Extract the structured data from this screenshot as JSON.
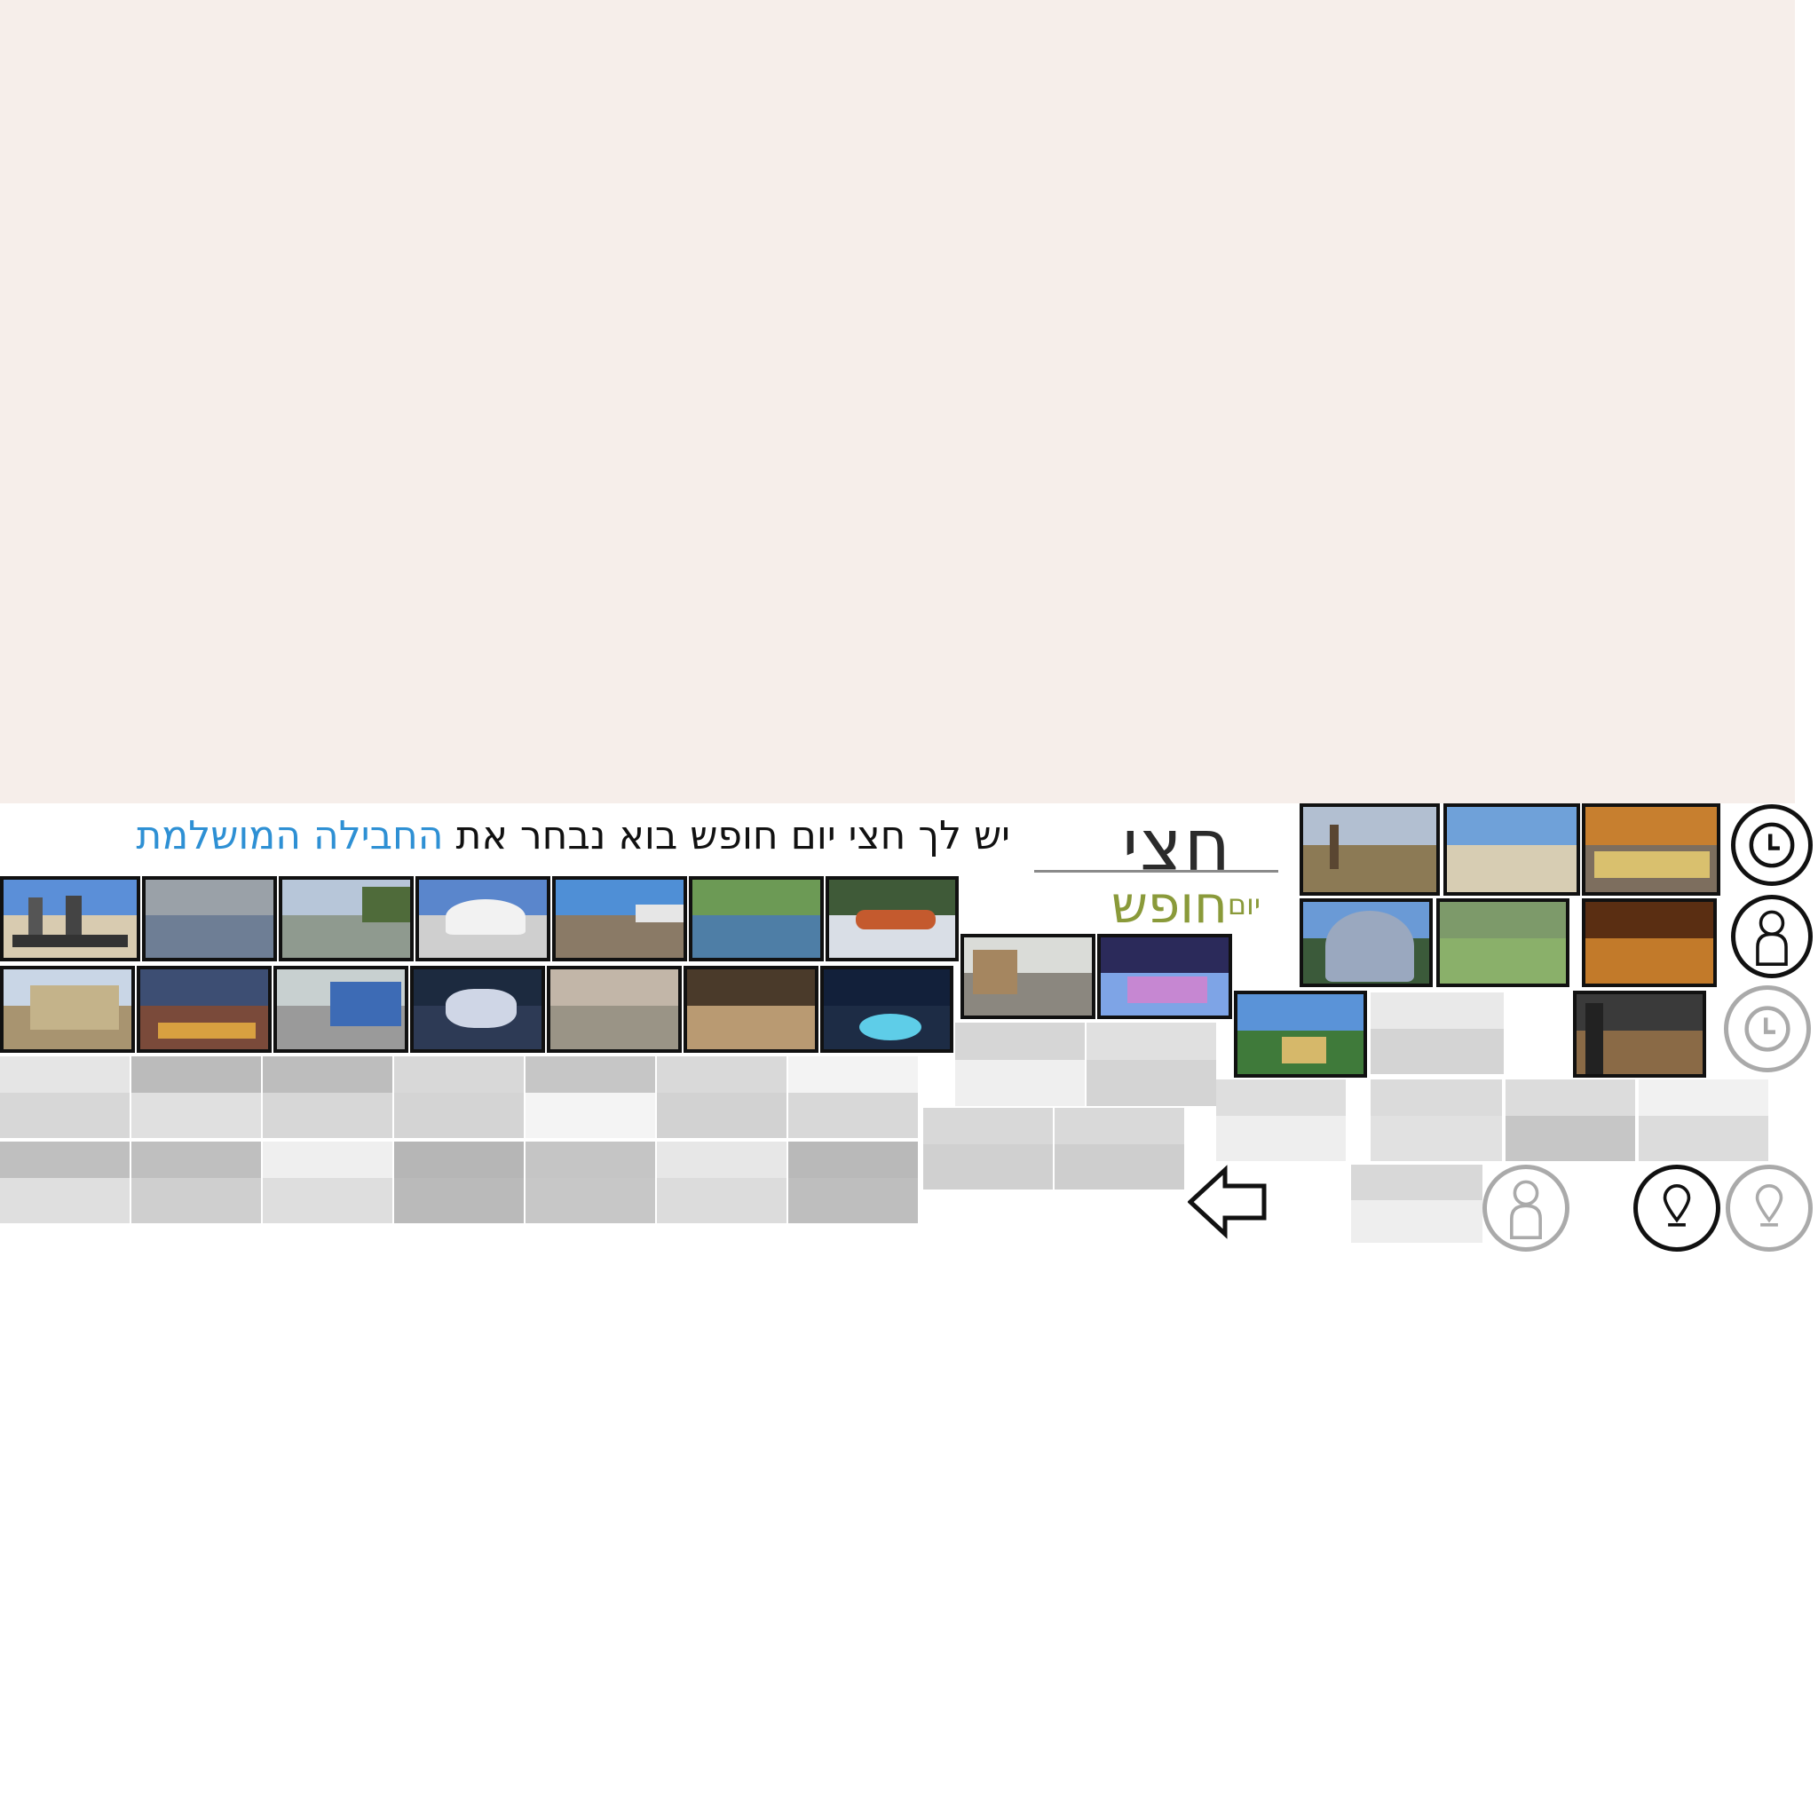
{
  "headline": {
    "prefix": "יש לך חצי יום חופש בוא נבחר את",
    "highlight": "החבילה המושלמת"
  },
  "logo": {
    "main": "חצי",
    "sub_small": "יום",
    "sub": "חופש"
  },
  "colors": {
    "background_top": "#f6eeea",
    "highlight": "#2e90d4",
    "logo_green": "#8a9a3a"
  },
  "icons": {
    "clock": "clock-icon",
    "person": "person-icon",
    "location": "location-pin-icon",
    "arrow": "arrow-left-icon"
  }
}
